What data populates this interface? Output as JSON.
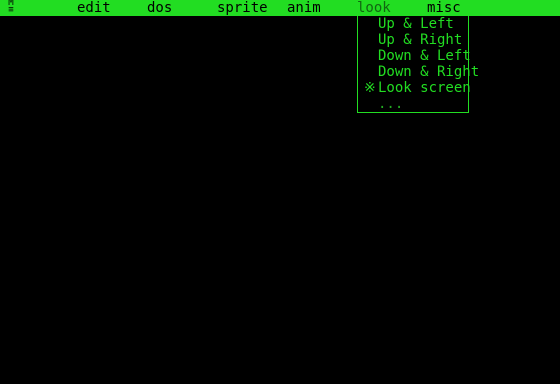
{
  "menubar": {
    "app_icon": "M\n≡",
    "menus": [
      "edit",
      "dos",
      "sprite",
      "anim",
      "look",
      "misc"
    ],
    "open_menu": "look"
  },
  "look_menu": {
    "items": [
      {
        "label": "Up & Left",
        "checked": false,
        "mark": ""
      },
      {
        "label": "Up & Right",
        "checked": false,
        "mark": ""
      },
      {
        "label": "Down & Left",
        "checked": false,
        "mark": ""
      },
      {
        "label": "Down & Right",
        "checked": false,
        "mark": ""
      },
      {
        "label": "Look screen",
        "checked": true,
        "mark": "※"
      },
      {
        "label": "...",
        "checked": false,
        "mark": ""
      }
    ]
  },
  "colors": {
    "accent": "#22dd22",
    "background": "#000000"
  }
}
